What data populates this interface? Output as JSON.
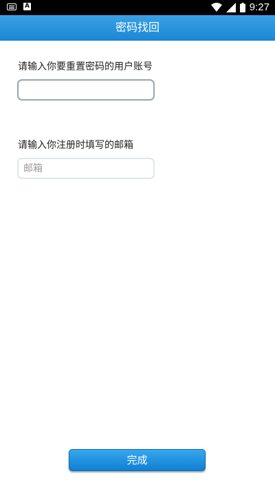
{
  "status_bar": {
    "time": "9:27",
    "icons": [
      "keyboard-icon",
      "a-notification-icon",
      "wifi-icon",
      "signal-icon",
      "battery-icon"
    ]
  },
  "header": {
    "title": "密码找回"
  },
  "form": {
    "account_label": "请输入你要重置密码的用户账号",
    "account_value": "",
    "account_placeholder": "",
    "email_label": "请输入你注册时填写的邮箱",
    "email_value": "",
    "email_placeholder": "邮箱"
  },
  "footer": {
    "done_label": "完成"
  },
  "colors": {
    "accent": "#1c88d6",
    "status_bar": "#000000",
    "background": "#ffffff"
  }
}
